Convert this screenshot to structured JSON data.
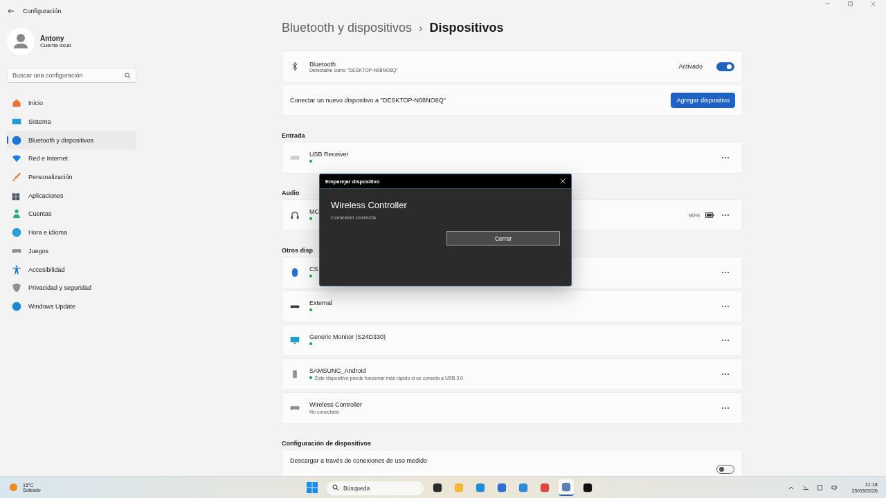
{
  "window": {
    "title": "Configuración"
  },
  "profile": {
    "name": "Antony",
    "account": "Cuenta local"
  },
  "search": {
    "placeholder": "Buscar una configuración"
  },
  "nav": [
    {
      "label": "Inicio",
      "selected": false
    },
    {
      "label": "Sistema",
      "selected": false
    },
    {
      "label": "Bluetooth y dispositivos",
      "selected": true
    },
    {
      "label": "Red e Internet",
      "selected": false
    },
    {
      "label": "Personalización",
      "selected": false
    },
    {
      "label": "Aplicaciones",
      "selected": false
    },
    {
      "label": "Cuentas",
      "selected": false
    },
    {
      "label": "Hora e idioma",
      "selected": false
    },
    {
      "label": "Juegos",
      "selected": false
    },
    {
      "label": "Accesibilidad",
      "selected": false
    },
    {
      "label": "Privacidad y seguridad",
      "selected": false
    },
    {
      "label": "Windows Update",
      "selected": false
    }
  ],
  "breadcrumb": {
    "parent": "Bluetooth y dispositivos",
    "separator": "›",
    "current": "Dispositivos"
  },
  "bluetooth": {
    "title": "Bluetooth",
    "subtitle": "Detectable como \"DESKTOP-N08NO8Q\"",
    "state_label": "Activado",
    "on": true
  },
  "add_device": {
    "text": "Conectar un nuevo dispositivo a \"DESKTOP-N08NO8Q\"",
    "button": "Agregar dispositivo"
  },
  "sections": [
    {
      "heading": "Entrada",
      "devices": [
        {
          "name": "USB Receiver",
          "connected": true
        }
      ]
    },
    {
      "heading": "Audio",
      "devices": [
        {
          "name": "MC",
          "connected": true,
          "battery": "90%"
        }
      ]
    },
    {
      "heading": "Otros disp",
      "devices": [
        {
          "name": "CS",
          "connected": true
        },
        {
          "name": "External",
          "connected": true
        },
        {
          "name": "Generic Monitor (S24D330)",
          "connected": true
        },
        {
          "name": "SAMSUNG_Android",
          "connected": true,
          "status": "Este dispositivo puede funcionar más rápido si se conecta a USB 3.0"
        },
        {
          "name": "Wireless Controller",
          "connected": false,
          "status": "No conectado"
        }
      ]
    },
    {
      "heading": "Configuración de dispositivos",
      "devices": [
        {
          "name": "Descargar a través de conexiones de uso medido",
          "kind": "toggle",
          "on": false
        }
      ]
    }
  ],
  "dialog": {
    "title": "Emparejar dispositivo",
    "device": "Wireless Controller",
    "message": "Conexión correcta",
    "button": "Cerrar"
  },
  "taskbar": {
    "weather": {
      "temp": "15°C",
      "condition": "Soleado"
    },
    "search_placeholder": "Búsqueda",
    "apps": [
      {
        "selected": false
      },
      {
        "selected": false
      },
      {
        "selected": false
      },
      {
        "selected": false
      },
      {
        "selected": false
      },
      {
        "selected": false
      },
      {
        "selected": true
      },
      {
        "selected": false
      }
    ],
    "time": "11:18",
    "date": "25/03/2026"
  }
}
